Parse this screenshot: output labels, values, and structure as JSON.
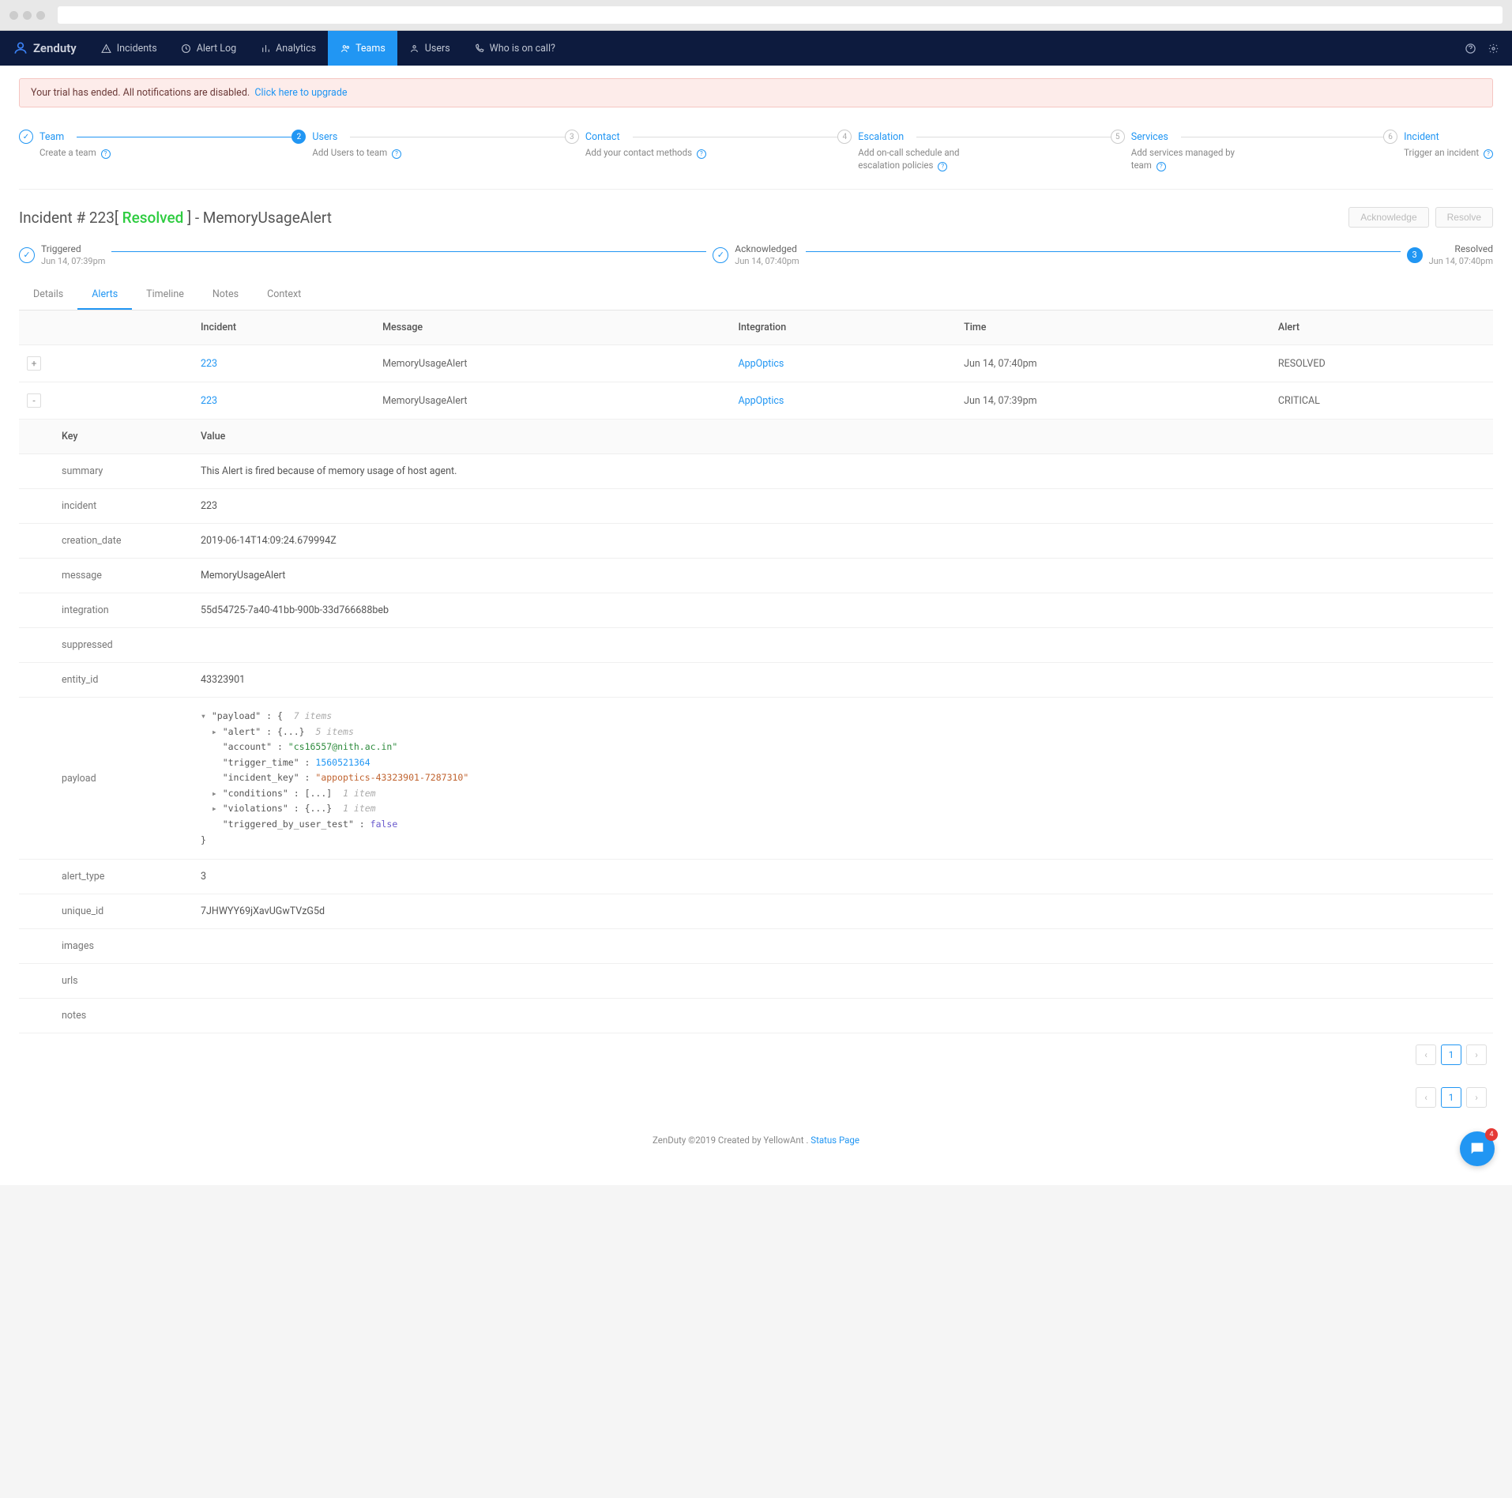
{
  "brand": "Zenduty",
  "nav": {
    "incidents": "Incidents",
    "alert_log": "Alert Log",
    "analytics": "Analytics",
    "teams": "Teams",
    "users": "Users",
    "oncall": "Who is on call?"
  },
  "banner": {
    "text": "Your trial has ended. All notifications are disabled.",
    "link": "Click here to upgrade"
  },
  "onboard": {
    "team": {
      "title": "Team",
      "desc": "Create a team"
    },
    "users": {
      "title": "Users",
      "num": "2",
      "desc": "Add Users to team"
    },
    "contact": {
      "title": "Contact",
      "num": "3",
      "desc": "Add your contact methods"
    },
    "escalation": {
      "title": "Escalation",
      "num": "4",
      "desc": "Add on-call schedule and escalation policies"
    },
    "services": {
      "title": "Services",
      "num": "5",
      "desc": "Add services managed by team"
    },
    "incident": {
      "title": "Incident",
      "num": "6",
      "desc": "Trigger an incident"
    }
  },
  "incident": {
    "prefix": "Incident # 223[ ",
    "status": "Resolved",
    "suffix": " ] - MemoryUsageAlert",
    "ack_btn": "Acknowledge",
    "res_btn": "Resolve"
  },
  "timeline": {
    "triggered": {
      "label": "Triggered",
      "time": "Jun 14, 07:39pm"
    },
    "acknowledged": {
      "label": "Acknowledged",
      "time": "Jun 14, 07:40pm"
    },
    "resolved": {
      "label": "Resolved",
      "num": "3",
      "time": "Jun 14, 07:40pm"
    }
  },
  "tabs": {
    "details": "Details",
    "alerts": "Alerts",
    "timeline": "Timeline",
    "notes": "Notes",
    "context": "Context"
  },
  "table": {
    "headers": {
      "incident": "Incident",
      "message": "Message",
      "integration": "Integration",
      "time": "Time",
      "alert": "Alert"
    },
    "rows": [
      {
        "exp": "+",
        "incident": "223",
        "message": "MemoryUsageAlert",
        "integration": "AppOptics",
        "time": "Jun 14, 07:40pm",
        "alert": "RESOLVED"
      },
      {
        "exp": "-",
        "incident": "223",
        "message": "MemoryUsageAlert",
        "integration": "AppOptics",
        "time": "Jun 14, 07:39pm",
        "alert": "CRITICAL"
      }
    ]
  },
  "detail_headers": {
    "key": "Key",
    "value": "Value"
  },
  "details": {
    "summary": {
      "k": "summary",
      "v": "This Alert is fired because of memory usage of host agent."
    },
    "incident": {
      "k": "incident",
      "v": "223"
    },
    "creation_date": {
      "k": "creation_date",
      "v": "2019-06-14T14:09:24.679994Z"
    },
    "message": {
      "k": "message",
      "v": "MemoryUsageAlert"
    },
    "integration": {
      "k": "integration",
      "v": "55d54725-7a40-41bb-900b-33d766688beb"
    },
    "suppressed": {
      "k": "suppressed",
      "v": ""
    },
    "entity_id": {
      "k": "entity_id",
      "v": "43323901"
    },
    "payload_k": "payload",
    "alert_type": {
      "k": "alert_type",
      "v": "3"
    },
    "unique_id": {
      "k": "unique_id",
      "v": "7JHWYY69jXavUGwTVzG5d"
    },
    "images": {
      "k": "images",
      "v": ""
    },
    "urls": {
      "k": "urls",
      "v": ""
    },
    "notes": {
      "k": "notes",
      "v": ""
    }
  },
  "payload": {
    "label": "\"payload\" : {",
    "count7": "7 items",
    "alert": "\"alert\" : {...}",
    "count5": "5 items",
    "account_k": "\"account\" : ",
    "account_v": "\"cs16557@nith.ac.in\"",
    "trigger_k": "\"trigger_time\" : ",
    "trigger_v": "1560521364",
    "incident_k": "\"incident_key\" : ",
    "incident_v": "\"appoptics-43323901-7287310\"",
    "conditions": "\"conditions\" : [...]",
    "count1a": "1 item",
    "violations": "\"violations\" : {...}",
    "count1b": "1 item",
    "triggered_k": "\"triggered_by_user_test\" : ",
    "triggered_v": "false",
    "close": "}"
  },
  "page": "1",
  "footer": {
    "text": "ZenDuty ©2019 Created by YellowAnt . ",
    "link": "Status Page"
  },
  "chat_count": "4"
}
